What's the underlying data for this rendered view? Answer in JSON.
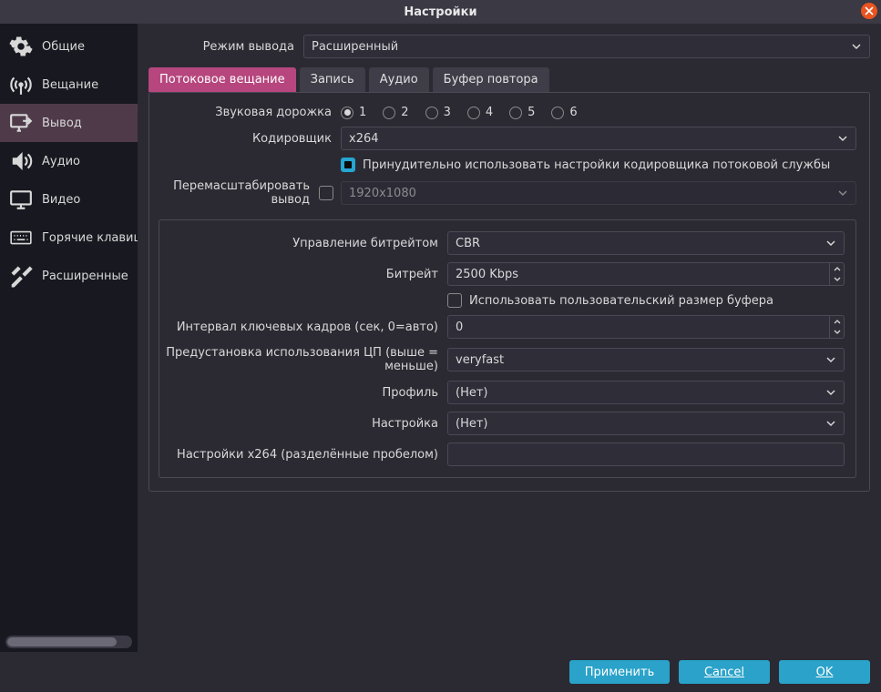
{
  "window": {
    "title": "Настройки"
  },
  "sidebar": {
    "items": [
      {
        "label": "Общие"
      },
      {
        "label": "Вещание"
      },
      {
        "label": "Вывод"
      },
      {
        "label": "Аудио"
      },
      {
        "label": "Видео"
      },
      {
        "label": "Горячие клавиши"
      },
      {
        "label": "Расширенные"
      }
    ],
    "active_index": 2
  },
  "output_mode": {
    "label": "Режим вывода",
    "value": "Расширенный"
  },
  "tabs": [
    {
      "label": "Потоковое вещание"
    },
    {
      "label": "Запись"
    },
    {
      "label": "Аудио"
    },
    {
      "label": "Буфер повтора"
    }
  ],
  "active_tab": 0,
  "stream": {
    "audio_track_label": "Звуковая дорожка",
    "audio_tracks": [
      "1",
      "2",
      "3",
      "4",
      "5",
      "6"
    ],
    "audio_track_selected": 0,
    "encoder_label": "Кодировщик",
    "encoder_value": "x264",
    "enforce_label": "Принудительно использовать настройки кодировщика потоковой службы",
    "enforce_checked": true,
    "rescale_label": "Перемасштабировать вывод",
    "rescale_checked": false,
    "rescale_value": "1920x1080"
  },
  "enc": {
    "rate_control_label": "Управление битрейтом",
    "rate_control_value": "CBR",
    "bitrate_label": "Битрейт",
    "bitrate_value": "2500 Kbps",
    "custom_buf_label": "Использовать пользовательский размер буфера",
    "custom_buf_checked": false,
    "keyint_label": "Интервал ключевых кадров (сек, 0=авто)",
    "keyint_value": "0",
    "preset_label": "Предустановка использования ЦП (выше = меньше)",
    "preset_value": "veryfast",
    "profile_label": "Профиль",
    "profile_value": "(Нет)",
    "tune_label": "Настройка",
    "tune_value": "(Нет)",
    "x264opts_label": "Настройки x264 (разделённые пробелом)",
    "x264opts_value": ""
  },
  "footer": {
    "apply": "Применить",
    "cancel": "Cancel",
    "ok": "OK"
  }
}
